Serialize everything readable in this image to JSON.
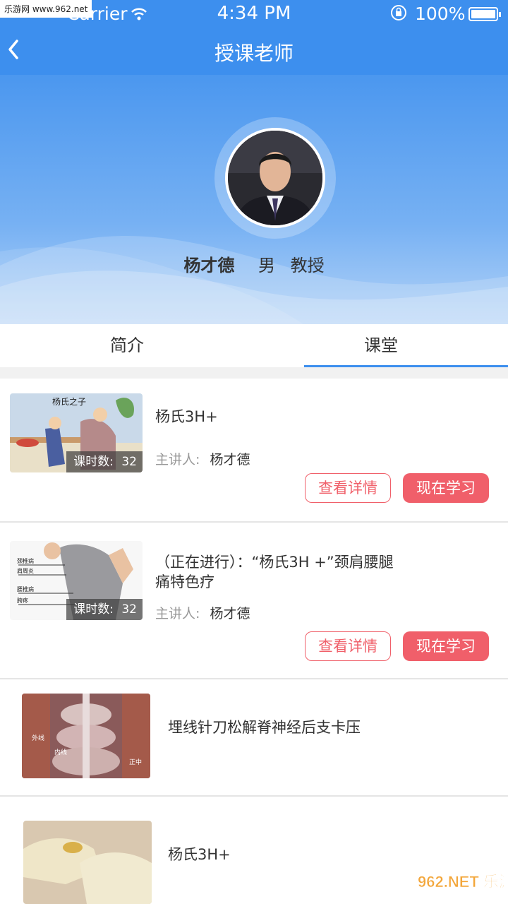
{
  "status_bar": {
    "carrier": "Carrier",
    "time": "4:34 PM",
    "battery": "100%",
    "watermark": "乐游网 www.962.net"
  },
  "nav": {
    "title": "授课老师",
    "back_icon": "chevron-left-icon"
  },
  "profile": {
    "name": "杨才德",
    "gender": "男",
    "title": "教授"
  },
  "tabs": [
    {
      "label": "简介",
      "active": false
    },
    {
      "label": "课堂",
      "active": true
    }
  ],
  "courses": [
    {
      "title": "杨氏3H+",
      "hours_label": "课时数:",
      "hours": "32",
      "lecturer_label": "主讲人:",
      "lecturer": "杨才德",
      "detail_button": "查看详情",
      "study_button": "现在学习",
      "thumb_caption": "杨氏之子"
    },
    {
      "title": "（正在进行）：“杨氏3H +”颈肩腰腿痛特色疗",
      "hours_label": "课时数:",
      "hours": "32",
      "lecturer_label": "主讲人:",
      "lecturer": "杨才德",
      "detail_button": "查看详情",
      "study_button": "现在学习",
      "thumb_labels": [
        "颈椎病",
        "肩周炎",
        "腰椎病",
        "胯疼"
      ]
    },
    {
      "title": "埋线针刀松解脊神经后支卡压",
      "thumb_labels": [
        "外线",
        "内线",
        "正中"
      ]
    },
    {
      "title": "杨氏3H+"
    }
  ],
  "watermark_br": "962.NET 乐游网",
  "colors": {
    "primary": "#3d8fee",
    "accent_red": "#f05f6a"
  }
}
